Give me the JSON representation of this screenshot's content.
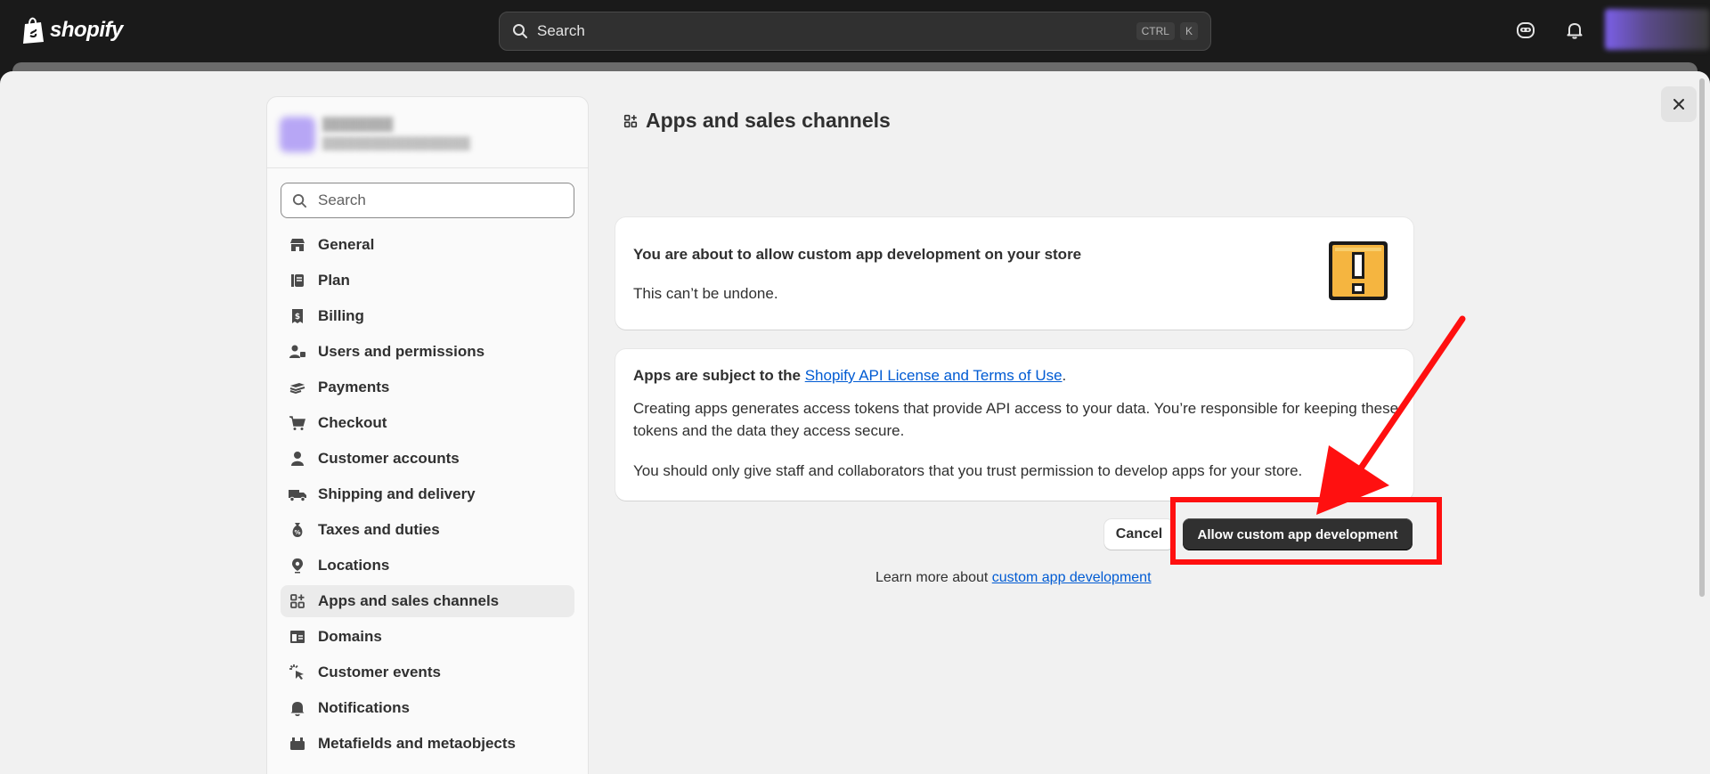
{
  "topbar": {
    "brand": "shopify",
    "search_placeholder": "Search",
    "shortcut_keys": [
      "CTRL",
      "K"
    ]
  },
  "sidebar": {
    "search_placeholder": "Search",
    "items": [
      {
        "label": "General",
        "icon": "store-icon",
        "active": false
      },
      {
        "label": "Plan",
        "icon": "plan-icon",
        "active": false
      },
      {
        "label": "Billing",
        "icon": "billing-icon",
        "active": false
      },
      {
        "label": "Users and permissions",
        "icon": "users-icon",
        "active": false
      },
      {
        "label": "Payments",
        "icon": "payments-icon",
        "active": false
      },
      {
        "label": "Checkout",
        "icon": "cart-icon",
        "active": false
      },
      {
        "label": "Customer accounts",
        "icon": "person-icon",
        "active": false
      },
      {
        "label": "Shipping and delivery",
        "icon": "truck-icon",
        "active": false
      },
      {
        "label": "Taxes and duties",
        "icon": "tax-bag-icon",
        "active": false
      },
      {
        "label": "Locations",
        "icon": "location-pin-icon",
        "active": false
      },
      {
        "label": "Apps and sales channels",
        "icon": "apps-icon",
        "active": true
      },
      {
        "label": "Domains",
        "icon": "domains-icon",
        "active": false
      },
      {
        "label": "Customer events",
        "icon": "cursor-click-icon",
        "active": false
      },
      {
        "label": "Notifications",
        "icon": "bell-icon",
        "active": false
      },
      {
        "label": "Metafields and metaobjects",
        "icon": "metafields-icon",
        "active": false
      }
    ]
  },
  "main": {
    "page_title": "Apps and sales channels",
    "warning_card": {
      "heading": "You are about to allow custom app development on your store",
      "subtext": "This can’t be undone."
    },
    "terms_card": {
      "prefix": "Apps are subject to the ",
      "link_text": "Shopify API License and Terms of Use",
      "suffix": ".",
      "paragraph": "Creating apps generates access tokens that provide API access to your data. You’re responsible for keeping these tokens and the data they access secure.",
      "note": "You should only give staff and collaborators that you trust permission to develop apps for your store."
    },
    "cancel_label": "Cancel",
    "allow_label": "Allow custom app development",
    "learn_prefix": "Learn more about ",
    "learn_link": "custom app development"
  },
  "colors": {
    "topbar_bg": "#1a1a1a",
    "modal_bg": "#f1f1f1",
    "primary_button": "#303030",
    "link": "#005bd3",
    "annotation_red": "#ff1010",
    "warning_yellow": "#f5b540"
  }
}
